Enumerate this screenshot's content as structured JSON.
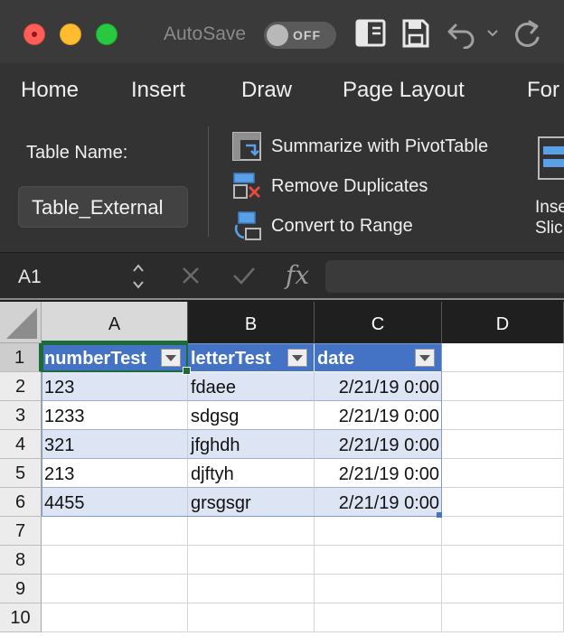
{
  "titlebar": {
    "autosave_label": "AutoSave",
    "autosave_state": "OFF"
  },
  "ribbon_tabs": [
    "Home",
    "Insert",
    "Draw",
    "Page Layout",
    "For"
  ],
  "ribbon": {
    "table_name_label": "Table Name:",
    "table_name_value": "Table_External",
    "commands": {
      "pivot": "Summarize with PivotTable",
      "remove_duplicates": "Remove Duplicates",
      "convert_range": "Convert to Range"
    },
    "slicer_label_line1": "Inse",
    "slicer_label_line2": "Slic"
  },
  "formula_bar": {
    "name_box": "A1",
    "fx_label": "fx",
    "formula": ""
  },
  "grid": {
    "columns": [
      "A",
      "B",
      "C",
      "D"
    ],
    "row_numbers": [
      "1",
      "2",
      "3",
      "4",
      "5",
      "6",
      "7",
      "8",
      "9",
      "10"
    ],
    "table_headers": [
      "numberTest",
      "letterTest",
      "date"
    ],
    "rows": [
      [
        "123",
        "fdaee",
        "2/21/19 0:00"
      ],
      [
        "1233",
        "sdgsg",
        "2/21/19 0:00"
      ],
      [
        "321",
        "jfghdh",
        "2/21/19 0:00"
      ],
      [
        "213",
        "djftyh",
        "2/21/19 0:00"
      ],
      [
        "4455",
        "grsgsgr",
        "2/21/19 0:00"
      ]
    ]
  },
  "colors": {
    "table_header": "#4472c4",
    "band": "#dde4f3",
    "selection": "#1d6b3a"
  }
}
